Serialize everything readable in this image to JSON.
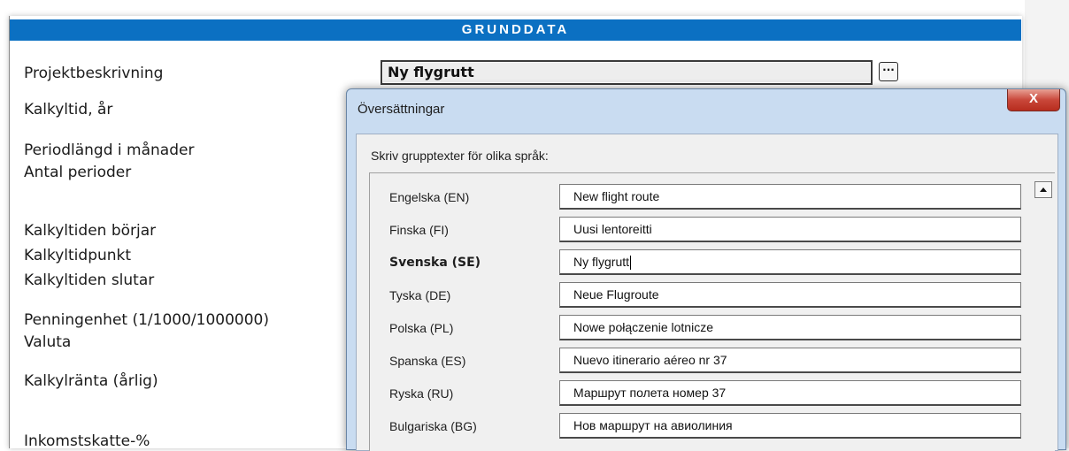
{
  "sheet": {
    "header": "GRUNDDATA",
    "rows": [
      "Projektbeskrivning",
      "Kalkyltid, år",
      "Periodlängd i månader",
      "Antal perioder",
      "Kalkyltiden börjar",
      "Kalkyltidpunkt",
      "Kalkyltiden slutar",
      "Penningenhet (1/1000/1000000)",
      "Valuta",
      "Kalkylränta (årlig)",
      "Inkomstskatte-%"
    ],
    "project_value": "Ny flygrutt",
    "more_button": "···"
  },
  "dialog": {
    "title": "Översättningar",
    "close": "X",
    "instruction": "Skriv grupptexter för olika språk:",
    "languages": [
      {
        "label": "Engelska (EN)",
        "value": "New flight route"
      },
      {
        "label": "Finska (FI)",
        "value": "Uusi lentoreitti"
      },
      {
        "label": "Svenska (SE)",
        "value": "Ny flygrutt"
      },
      {
        "label": "Tyska (DE)",
        "value": "Neue Flugroute"
      },
      {
        "label": "Polska (PL)",
        "value": "Nowe połączenie lotnicze"
      },
      {
        "label": "Spanska (ES)",
        "value": "Nuevo itinerario aéreo nr 37"
      },
      {
        "label": "Ryska (RU)",
        "value": "Маршрут полета номер 37"
      },
      {
        "label": "Bulgariska (BG)",
        "value": "Нов маршрут на авиолиния"
      }
    ]
  },
  "colors": {
    "header_bg": "#0b70c2",
    "dialog_frame": "#c9dcf1",
    "close_button": "#c9473a"
  }
}
